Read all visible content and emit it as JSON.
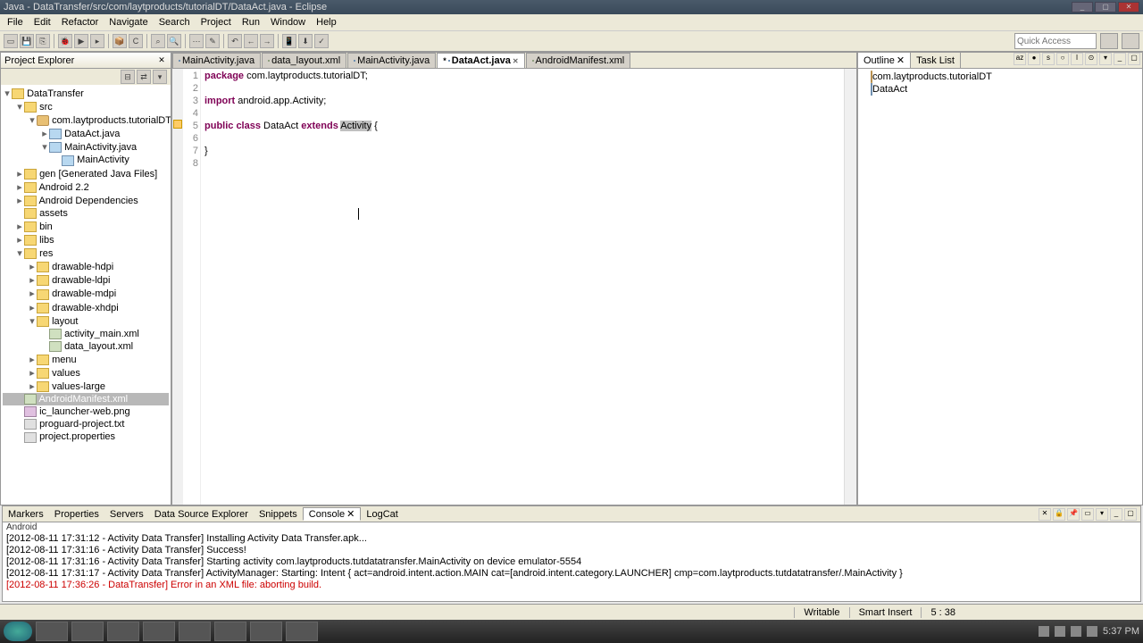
{
  "title": "Java - DataTransfer/src/com/laytproducts/tutorialDT/DataAct.java - Eclipse",
  "menu": [
    "File",
    "Edit",
    "Refactor",
    "Navigate",
    "Search",
    "Project",
    "Run",
    "Window",
    "Help"
  ],
  "quick_access_placeholder": "Quick Access",
  "project_explorer": {
    "title": "Project Explorer"
  },
  "tree": {
    "root": "DataTransfer",
    "src": "src",
    "pkg": "com.laytproducts.tutorialDT",
    "files_pkg": [
      "DataAct.java",
      "MainActivity.java",
      "MainActivity"
    ],
    "gen": "gen [Generated Java Files]",
    "android": "Android 2.2",
    "deps": "Android Dependencies",
    "assets": "assets",
    "bin": "bin",
    "libs": "libs",
    "res": "res",
    "drawable": [
      "drawable-hdpi",
      "drawable-ldpi",
      "drawable-mdpi",
      "drawable-xhdpi"
    ],
    "layout": "layout",
    "layout_files": [
      "activity_main.xml",
      "data_layout.xml"
    ],
    "menu": "menu",
    "values": "values",
    "values_large": "values-large",
    "manifest": "AndroidManifest.xml",
    "launcher": "ic_launcher-web.png",
    "proguard": "proguard-project.txt",
    "props": "project.properties"
  },
  "editor_tabs": [
    {
      "label": "MainActivity.java",
      "active": false
    },
    {
      "label": "data_layout.xml",
      "active": false
    },
    {
      "label": "MainActivity.java",
      "active": false
    },
    {
      "label": "DataAct.java",
      "active": true,
      "dirty": true
    },
    {
      "label": "AndroidManifest.xml",
      "active": false
    }
  ],
  "code": {
    "l1": "package com.laytproducts.tutorialDT;",
    "l2": "",
    "l3": "import android.app.Activity;",
    "l4": "",
    "l5_pre": "public class DataAct extends ",
    "l5_hl": "Activity",
    "l5_post": " {",
    "l6": "",
    "l7": "}",
    "l8": ""
  },
  "outline": {
    "title": "Outline",
    "tasklist": "Task List",
    "items": [
      "com.laytproducts.tutorialDT",
      "DataAct"
    ]
  },
  "bottom_tabs": [
    "Markers",
    "Properties",
    "Servers",
    "Data Source Explorer",
    "Snippets",
    "Console",
    "LogCat"
  ],
  "console": {
    "header": "Android",
    "lines": [
      {
        "t": "[2012-08-11 17:31:12 - Activity Data Transfer] Installing Activity Data Transfer.apk...",
        "err": false
      },
      {
        "t": "[2012-08-11 17:31:16 - Activity Data Transfer] Success!",
        "err": false
      },
      {
        "t": "[2012-08-11 17:31:16 - Activity Data Transfer] Starting activity com.laytproducts.tutdatatransfer.MainActivity on device emulator-5554",
        "err": false
      },
      {
        "t": "[2012-08-11 17:31:17 - Activity Data Transfer] ActivityManager: Starting: Intent { act=android.intent.action.MAIN cat=[android.intent.category.LAUNCHER] cmp=com.laytproducts.tutdatatransfer/.MainActivity }",
        "err": false
      },
      {
        "t": "[2012-08-11 17:36:26 - DataTransfer] Error in an XML file: aborting build.",
        "err": true
      }
    ]
  },
  "status": {
    "writable": "Writable",
    "insert": "Smart Insert",
    "pos": "5 : 38"
  },
  "tray_time": "5:37 PM"
}
